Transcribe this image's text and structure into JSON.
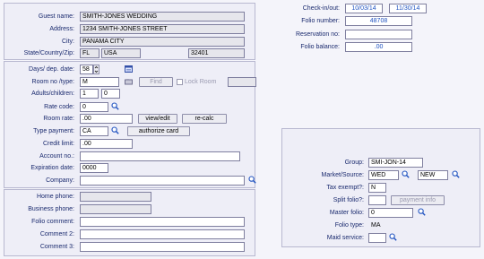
{
  "guest": {
    "name_label": "Guest name:",
    "name_value": "SMITH-JONES WEDDING",
    "address_label": "Address:",
    "address_value": "1234 SMITH-JONES STREET",
    "city_label": "City:",
    "city_value": "PANAMA CITY",
    "scz_label": "State/Country/Zip:",
    "state_value": "FL",
    "country_value": "USA",
    "zip_value": "32401"
  },
  "stay": {
    "days_label": "Days/ dep. date:",
    "days_value": "58",
    "room_label": "Room no /type:",
    "room_value": "M",
    "find_button": "Find",
    "lock_room_label": "Lock Room",
    "adults_label": "Adults/children:",
    "adults_value": "1",
    "children_value": "0",
    "rate_code_label": "Rate code:",
    "rate_code_value": "0",
    "room_rate_label": "Room rate:",
    "room_rate_value": ".00",
    "view_edit_button": "view/edit",
    "recalc_button": "re-calc",
    "type_payment_label": "Type payment:",
    "type_payment_value": "CA",
    "authorize_button": "authorize card",
    "credit_limit_label": "Credit limit:",
    "credit_limit_value": ".00",
    "account_label": "Account no.:",
    "account_value": "",
    "expiration_label": "Expiration date:",
    "expiration_value": "0000",
    "company_label": "Company:",
    "company_value": ""
  },
  "contact": {
    "home_phone_label": "Home phone:",
    "home_phone_value": "",
    "business_phone_label": "Business phone:",
    "business_phone_value": "",
    "folio_comment_label": "Folio comment:",
    "folio_comment_value": "",
    "comment2_label": "Comment 2:",
    "comment2_value": "",
    "comment3_label": "Comment 3:",
    "comment3_value": ""
  },
  "folio": {
    "checkinout_label": "Check-in/out:",
    "checkin_value": "10/03/14",
    "checkout_value": "11/30/14",
    "folio_number_label": "Folio number:",
    "folio_number_value": "48708",
    "reservation_label": "Reservation no:",
    "reservation_value": "",
    "balance_label": "Folio balance:",
    "balance_value": ".00"
  },
  "group": {
    "group_label": "Group:",
    "group_value": "SMI-JON-14",
    "market_label": "Market/Source:",
    "market_value": "WED",
    "source_value": "NEW",
    "tax_exempt_label": "Tax exempt?:",
    "tax_exempt_value": "N",
    "split_folio_label": "Split folio?:",
    "split_folio_value": "",
    "payment_info_button": "payment info",
    "master_folio_label": "Master folio:",
    "master_folio_value": "0",
    "folio_type_label": "Folio type:",
    "folio_type_value": "MA",
    "maid_service_label": "Maid service:",
    "maid_service_value": ""
  },
  "icons": {
    "lookup": "magnifier-icon",
    "calendar": "calendar-icon",
    "room_plan": "room-plan-icon"
  }
}
